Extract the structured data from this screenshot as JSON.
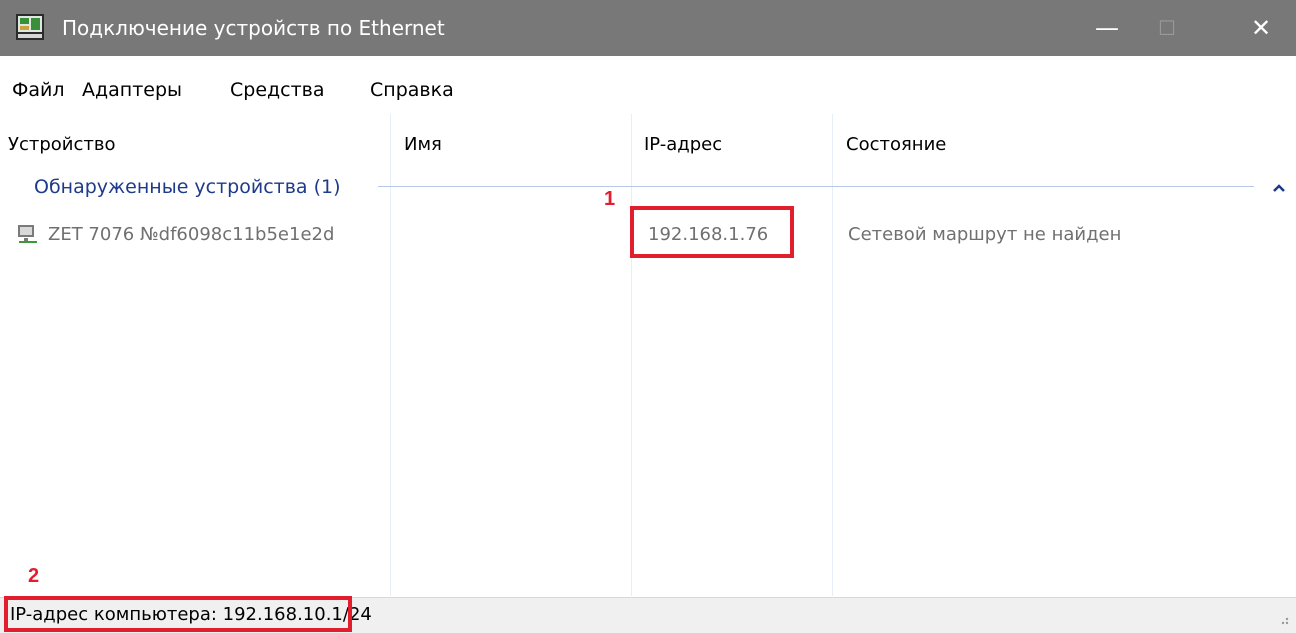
{
  "window": {
    "title": "Подключение устройств по Ethernet",
    "controls": {
      "minimize": "—",
      "maximize": "☐",
      "close": "✕"
    }
  },
  "menu": [
    "Файл",
    "Адаптеры",
    "Средства",
    "Справка"
  ],
  "columns": [
    "Устройство",
    "Имя",
    "IP-адрес",
    "Состояние"
  ],
  "group": {
    "label": "Обнаруженные устройства (1)",
    "icon": "chevron-up-icon"
  },
  "devices": [
    {
      "icon": "network-device-icon",
      "device": "ZET 7076 №df6098c11b5e1e2d",
      "name": "",
      "ip": "192.168.1.76",
      "status": "Сетевой маршрут не найден"
    }
  ],
  "annotations": {
    "callout1": "1",
    "callout2": "2",
    "color": "#e11d2e"
  },
  "statusbar": {
    "text": "IP-адрес компьютера: 192.168.10.1/24"
  },
  "colors": {
    "titlebar": "#787878",
    "group_text": "#1e3a8a",
    "disabled_text": "#707070"
  }
}
